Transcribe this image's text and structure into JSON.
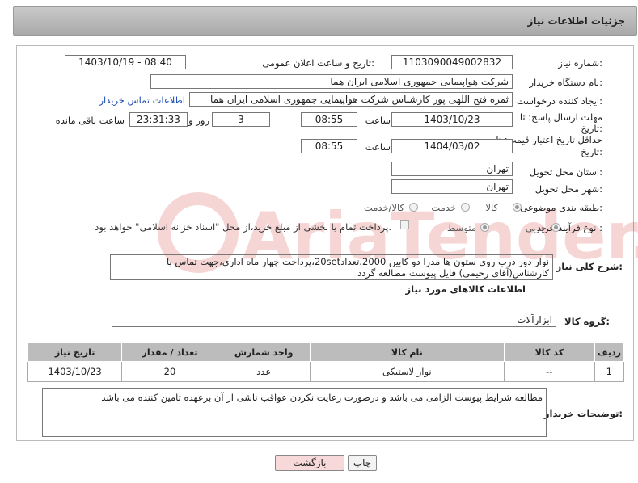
{
  "header": {
    "title": "جزئیات اطلاعات نیاز"
  },
  "form": {
    "need_number": {
      "label": "شماره نیاز:",
      "value": "1103090049002832"
    },
    "announce_datetime": {
      "label": "تاریخ و ساعت اعلان عمومی:",
      "value": "1403/10/19 - 08:40"
    },
    "buyer_org": {
      "label": "نام دستگاه خریدار:",
      "value": "شرکت هواپیمایی جمهوری اسلامی ایران هما"
    },
    "requester": {
      "label": "ایجاد کننده درخواست:",
      "value": "ثمره فتح اللهی پور کارشناس شرکت هواپیمایی جمهوری اسلامی ایران هما",
      "contact_link": "اطلاعات تماس خریدار"
    },
    "reply_deadline": {
      "label_line1": "مهلت ارسال پاسخ: تا",
      "label_line2": "تاریخ:",
      "date": "1403/10/23",
      "time_label": "ساعت",
      "time": "08:55",
      "days": "3",
      "days_label": "روز و",
      "remaining": "23:31:33",
      "remaining_label": "ساعت باقی مانده"
    },
    "price_validity": {
      "label_line1": "حداقل تاریخ اعتبار قیمت: تا",
      "label_line2": "تاریخ:",
      "date": "1404/03/02",
      "time_label": "ساعت",
      "time": "08:55"
    },
    "province": {
      "label": "استان محل تحویل:",
      "value": "تهران"
    },
    "city": {
      "label": "شهر محل تحویل:",
      "value": "تهران"
    },
    "category": {
      "label": "طبقه بندی موضوعی:",
      "options": [
        "کالا",
        "خدمت",
        "کالا/خدمت"
      ],
      "selected": "کالا"
    },
    "purchase_type": {
      "label": "نوع فرآیند خرید :",
      "options": [
        "جزیی",
        "متوسط"
      ],
      "selected": "جزیی",
      "payment_note": "پرداخت تمام یا بخشی از مبلغ خرید،از محل \"اسناد خزانه اسلامی\" خواهد بود."
    },
    "description": {
      "label": "شرح کلی نیاز:",
      "value": "نوار دور درب روی ستون ها مدرا دو کابین 2000،تعداد20set،پرداخت چهار ماه اداری،جهت تماس با کارشناس(آقای رحیمی) فایل پیوست مطالعه گردد"
    }
  },
  "goods": {
    "section_title": "اطلاعات کالاهای مورد نیاز",
    "group_label": "گروه کالا:",
    "group_value": "ابزارآلات",
    "columns": [
      "ردیف",
      "کد کالا",
      "نام کالا",
      "واحد شمارش",
      "تعداد / مقدار",
      "تاریخ نیاز"
    ],
    "rows": [
      {
        "row": "1",
        "code": "--",
        "name": "نوار لاستیکی",
        "unit": "عدد",
        "qty": "20",
        "date": "1403/10/23"
      }
    ]
  },
  "buyer_notes": {
    "label": "توضیحات خریدار:",
    "value": "مطالعه شرایط پیوست الزامی می باشد و درصورت رعایت نکردن عواقب ناشی از آن برعهده تامین کننده می باشد"
  },
  "actions": {
    "print": "چاپ",
    "back": "بازگشت"
  },
  "watermark": {
    "text": "AriaTender.neT"
  },
  "colors": {
    "link": "#1f4fb3",
    "header": "#b5b5b5",
    "back_button": "#f7d9d9"
  }
}
